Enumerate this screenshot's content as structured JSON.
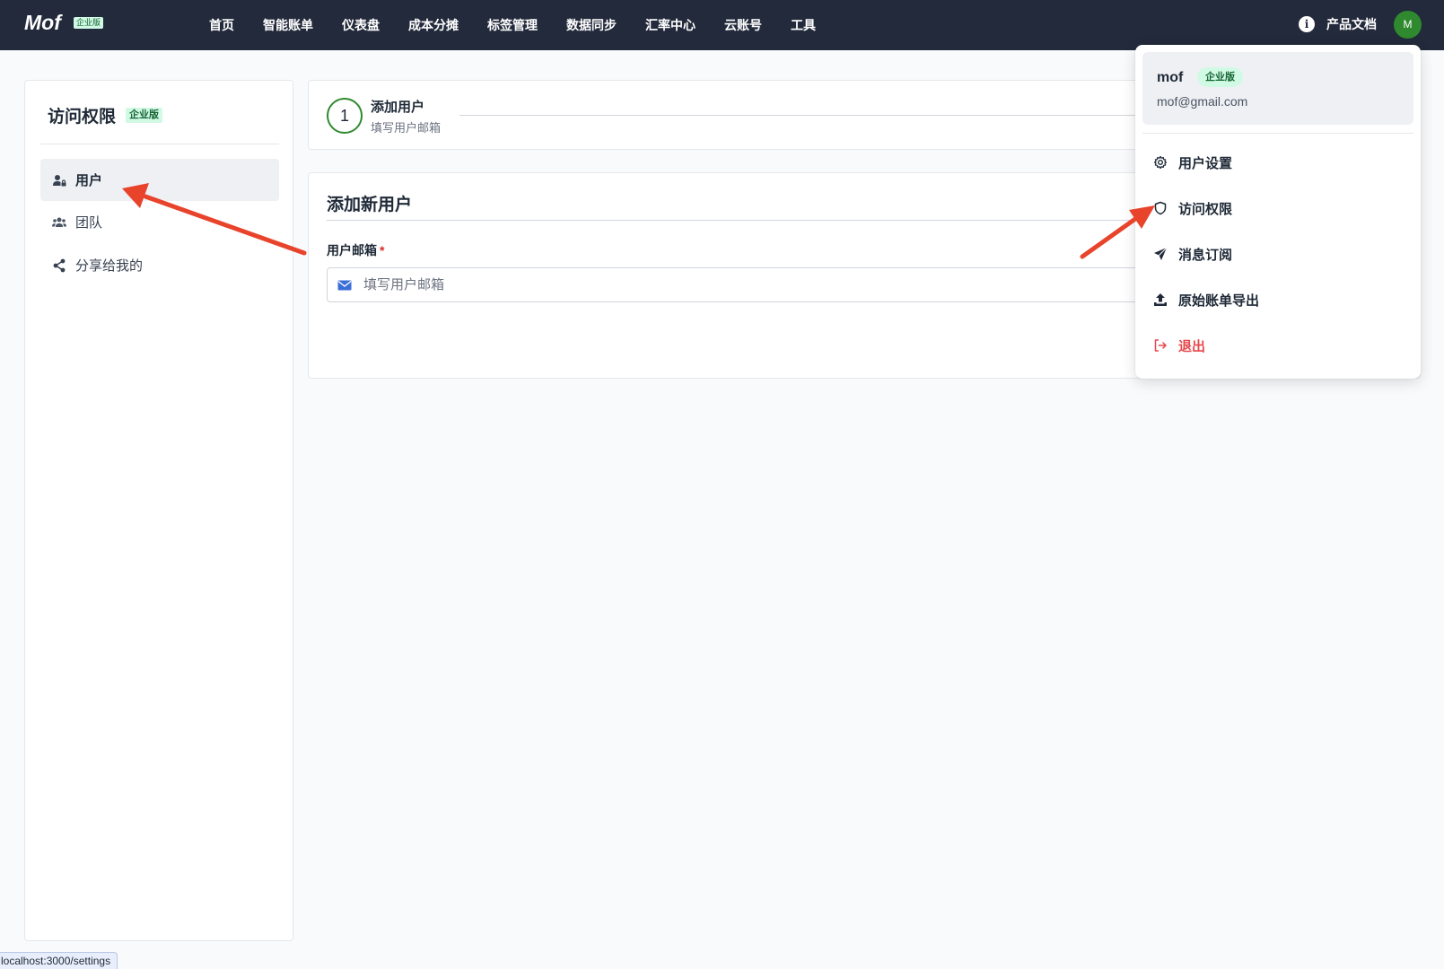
{
  "header": {
    "brand": "Mof",
    "brand_badge": "企业版",
    "nav": [
      "首页",
      "智能账单",
      "仪表盘",
      "成本分摊",
      "标签管理",
      "数据同步",
      "汇率中心",
      "云账号",
      "工具"
    ],
    "docs_label": "产品文档",
    "avatar_initial": "M",
    "avatar_color": "#2f8a2f"
  },
  "sidebar": {
    "title": "访问权限",
    "badge": "企业版",
    "items": [
      {
        "label": "用户",
        "icon": "user-lock-icon",
        "active": true
      },
      {
        "label": "团队",
        "icon": "users-icon",
        "active": false
      },
      {
        "label": "分享给我的",
        "icon": "share-icon",
        "active": false
      }
    ]
  },
  "stepper": {
    "step_number": "1",
    "step_title": "添加用户",
    "step_desc": "填写用户邮箱"
  },
  "form": {
    "title": "添加新用户",
    "email_label": "用户邮箱",
    "required_mark": "*",
    "email_placeholder": "填写用户邮箱",
    "email_value": ""
  },
  "dropdown": {
    "user_name": "mof",
    "user_badge": "企业版",
    "user_email": "mof@gmail.com",
    "items": [
      {
        "label": "用户设置",
        "icon": "gear-icon"
      },
      {
        "label": "访问权限",
        "icon": "shield-icon"
      },
      {
        "label": "消息订阅",
        "icon": "send-icon"
      },
      {
        "label": "原始账单导出",
        "icon": "upload-icon"
      },
      {
        "label": "退出",
        "icon": "logout-icon",
        "danger": true
      }
    ]
  },
  "statusbar": {
    "url": "localhost:3000/settings"
  },
  "colors": {
    "topbar": "#232a3b",
    "accent_green": "#2f8a2f",
    "badge_bg": "#d1fae5",
    "danger": "#e5484d",
    "annotation_arrow": "#e8432b"
  }
}
